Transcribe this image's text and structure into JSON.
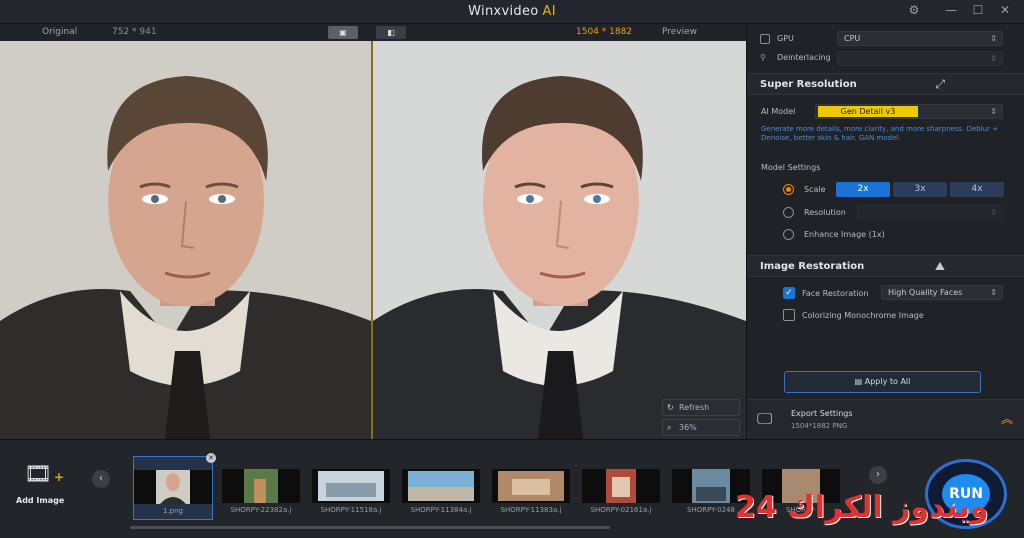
{
  "titlebar": {
    "app_name": "Winxvideo",
    "app_suffix": "AI"
  },
  "viewer": {
    "original_label": "Original",
    "original_dims": "752 * 941",
    "output_dims": "1504 * 1882",
    "preview_label": "Preview",
    "refresh_label": "Refresh",
    "zoom_label": "36%"
  },
  "panel": {
    "gpu_label": "GPU",
    "gpu_value": "CPU",
    "deinterlacing_label": "Deinterlacing",
    "super_resolution": {
      "title": "Super Resolution",
      "ai_model_label": "AI Model",
      "ai_model_value": "Gen Detail v3",
      "description": "Generate more details, more clarity, and more sharpness. Deblur + Denoise, better skin & hair. GAN model.",
      "model_settings_label": "Model Settings",
      "scale_label": "Scale",
      "scale_options": [
        "2x",
        "3x",
        "4x"
      ],
      "resolution_label": "Resolution",
      "enhance_label": "Enhance Image (1x)"
    },
    "image_restoration": {
      "title": "Image Restoration",
      "face_restoration_label": "Face Restoration",
      "face_restoration_value": "High Quality Faces",
      "colorize_label": "Colorizing Monochrome Image"
    },
    "apply_label": "Apply to All",
    "export": {
      "title": "Export Settings",
      "detail": "1504*1882  PNG"
    }
  },
  "bottom": {
    "add_image_label": "Add Image",
    "thumbnails": [
      {
        "label": "1.png"
      },
      {
        "label": "SHORPY-22382a.j"
      },
      {
        "label": "SHORPY-11518a.j"
      },
      {
        "label": "SHORPY-11384a.j"
      },
      {
        "label": "SHORPY-11383a.j"
      },
      {
        "label": "SHORPY-02161a.j"
      },
      {
        "label": "SHORPY-0248"
      },
      {
        "label": "SHORPY-"
      }
    ],
    "run_label": "RUN"
  },
  "watermark": "24 ويندوز الكراك",
  "colors": {
    "accent": "#1a74d6",
    "brand": "#f0b400",
    "model_highlight": "#f0c800"
  }
}
